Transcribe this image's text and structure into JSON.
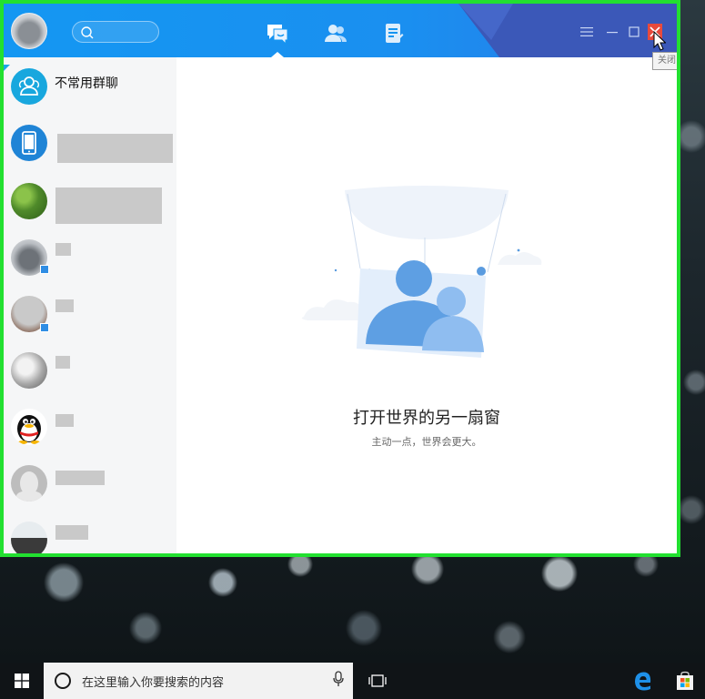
{
  "window": {
    "tabs": [
      {
        "name": "messages",
        "icon": "chat-bubble-icon",
        "active": true
      },
      {
        "name": "contacts",
        "icon": "contacts-icon",
        "active": false
      },
      {
        "name": "space",
        "icon": "document-icon",
        "active": false
      }
    ],
    "controls": [
      "menu-icon",
      "minimize-icon",
      "maximize-icon",
      "close-icon"
    ],
    "tooltip": "关闭"
  },
  "sidebar": {
    "items": [
      {
        "label": "不常用群聊",
        "icon": "group-icon"
      },
      {
        "label": "",
        "icon": "phone-icon"
      },
      {
        "label": "",
        "icon": ""
      },
      {
        "label": "",
        "icon": ""
      },
      {
        "label": "",
        "icon": ""
      },
      {
        "label": "",
        "icon": ""
      },
      {
        "label": "",
        "icon": "penguin-icon"
      },
      {
        "label": "",
        "icon": ""
      },
      {
        "label": "",
        "icon": ""
      }
    ]
  },
  "main": {
    "empty_title": "打开世界的另一扇窗",
    "empty_subtitle": "主动一点，世界会更大。"
  },
  "taskbar": {
    "search_placeholder": "在这里输入你要搜索的内容"
  },
  "colors": {
    "titlebar": "#1497f2",
    "frame_highlight": "#22e030",
    "accent": "#2f8de4"
  }
}
